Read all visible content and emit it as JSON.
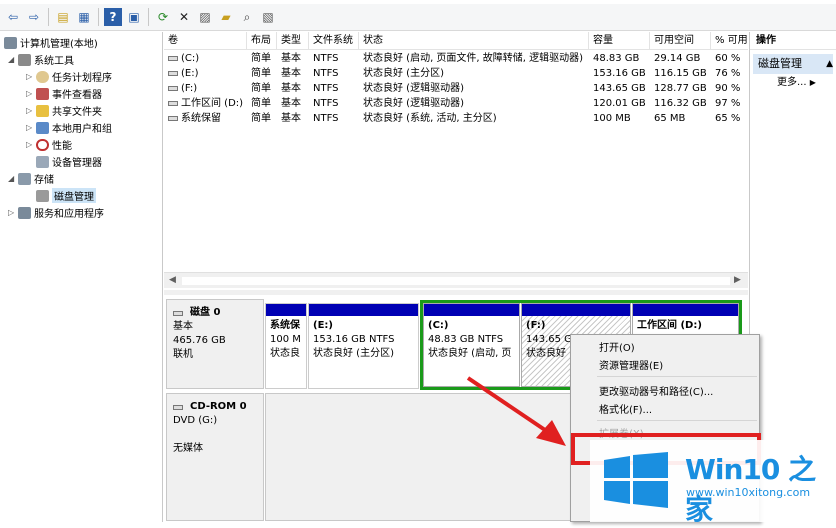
{
  "toolbar": {
    "icons": [
      "back-icon",
      "forward-icon",
      "up-icon",
      "show-hide-tree-icon",
      "help-icon",
      "properties-icon",
      "refresh-icon",
      "delete-icon",
      "properties2-icon",
      "open-icon",
      "search-icon",
      "export-icon"
    ]
  },
  "tree": {
    "root": "计算机管理(本地)",
    "system_tools": "系统工具",
    "task_scheduler": "任务计划程序",
    "event_viewer": "事件查看器",
    "shared_folders": "共享文件夹",
    "local_users": "本地用户和组",
    "performance": "性能",
    "device_manager": "设备管理器",
    "storage": "存储",
    "disk_management": "磁盘管理",
    "services": "服务和应用程序"
  },
  "volumes": {
    "headers": [
      "卷",
      "布局",
      "类型",
      "文件系统",
      "状态",
      "容量",
      "可用空间",
      "% 可用"
    ],
    "rows": [
      [
        "(C:)",
        "简单",
        "基本",
        "NTFS",
        "状态良好 (启动, 页面文件, 故障转储, 逻辑驱动器)",
        "48.83 GB",
        "29.14 GB",
        "60 %"
      ],
      [
        "(E:)",
        "简单",
        "基本",
        "NTFS",
        "状态良好 (主分区)",
        "153.16 GB",
        "116.15 GB",
        "76 %"
      ],
      [
        "(F:)",
        "简单",
        "基本",
        "NTFS",
        "状态良好 (逻辑驱动器)",
        "143.65 GB",
        "128.77 GB",
        "90 %"
      ],
      [
        "工作区间 (D:)",
        "简单",
        "基本",
        "NTFS",
        "状态良好 (逻辑驱动器)",
        "120.01 GB",
        "116.32 GB",
        "97 %"
      ],
      [
        "系统保留",
        "简单",
        "基本",
        "NTFS",
        "状态良好 (系统, 活动, 主分区)",
        "100 MB",
        "65 MB",
        "65 %"
      ]
    ]
  },
  "disk0": {
    "name": "磁盘 0",
    "type": "基本",
    "size": "465.76 GB",
    "status": "联机",
    "partitions": [
      {
        "name": "系统保",
        "size": "100 M",
        "status": "状态良"
      },
      {
        "name": "(E:)",
        "size": "153.16 GB NTFS",
        "status": "状态良好 (主分区)"
      },
      {
        "name": "(C:)",
        "size": "48.83 GB NTFS",
        "status": "状态良好 (启动, 页"
      },
      {
        "name": "(F:)",
        "size": "143.65 G",
        "status": "状态良好"
      },
      {
        "name": "工作区间  (D:)",
        "size": "",
        "status": ""
      }
    ]
  },
  "cdrom": {
    "name": "CD-ROM 0",
    "drive": "DVD (G:)",
    "media": "无媒体"
  },
  "actions": {
    "header": "操作",
    "section": "磁盘管理",
    "more": "更多..."
  },
  "context_menu": {
    "open": "打开(O)",
    "explorer": "资源管理器(E)",
    "change_letter": "更改驱动器号和路径(C)...",
    "format": "格式化(F)...",
    "extend": "扩展卷(X)..."
  },
  "watermark": {
    "brand": "Win10 之家",
    "url": "www.win10xitong.com"
  },
  "colors": {
    "accent_blue": "#0000b4",
    "selected_green": "#1a9a1a",
    "highlight_red": "#e02020",
    "brand_blue": "#1a8fe0"
  }
}
